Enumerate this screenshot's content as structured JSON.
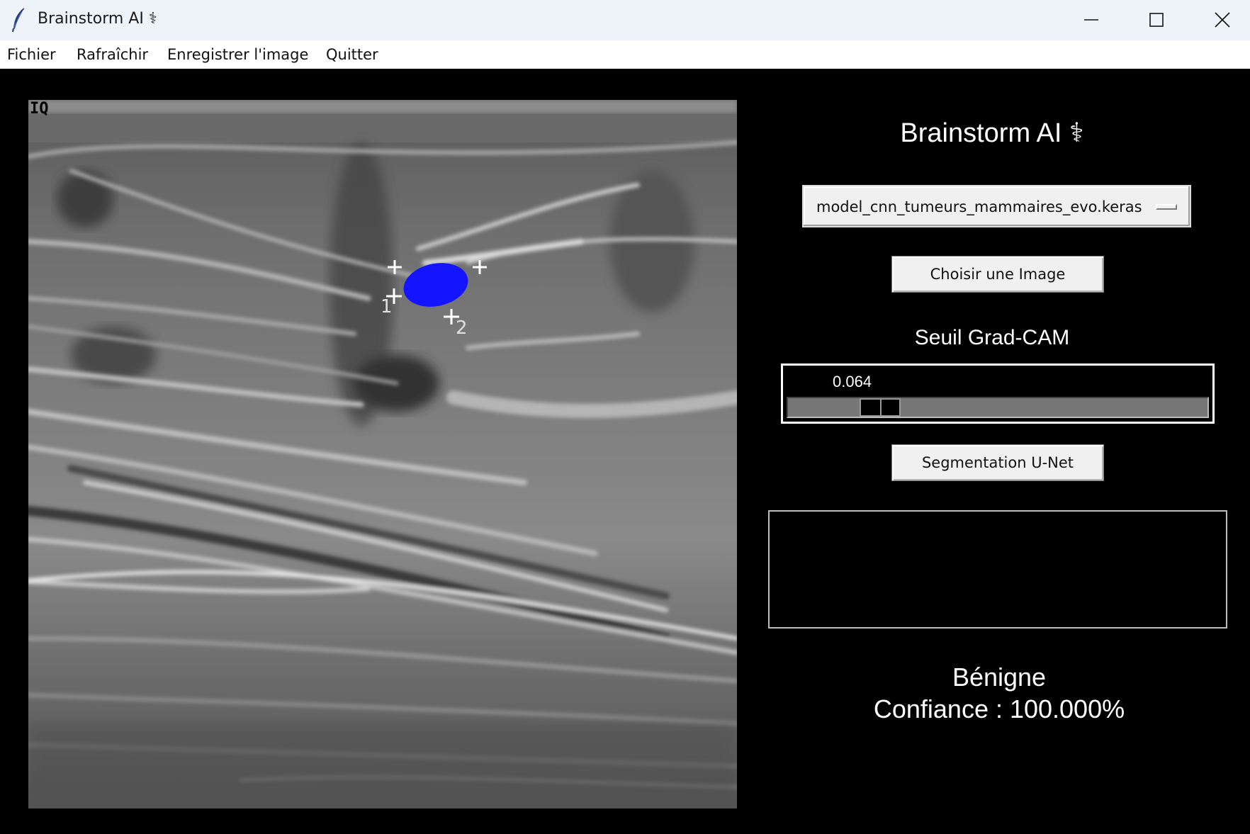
{
  "window": {
    "title": "Brainstorm AI ⚕",
    "app_icon": "feather-icon",
    "controls": [
      "minimize-icon",
      "maximize-icon",
      "close-icon"
    ]
  },
  "menu": {
    "items": [
      "Fichier",
      "Rafraîchir",
      "Enregistrer l'image",
      "Quitter"
    ]
  },
  "image": {
    "overlay_label": "IQ",
    "markers": [
      "1",
      "2"
    ],
    "segmentation_color": "#1414ff"
  },
  "panel": {
    "title": "Brainstorm AI  ⚕",
    "model_select": "model_cnn_tumeurs_mammaires_evo.keras",
    "choose_button": "Choisir une Image",
    "threshold_label": "Seuil Grad-CAM",
    "threshold": {
      "value_text": "0.064",
      "value": 0.064,
      "min": 0.0,
      "max": 1.0
    },
    "segmentation_button": "Segmentation U-Net",
    "prediction": "Bénigne",
    "confidence": "Confiance : 100.000%"
  },
  "colors": {
    "background": "#000000",
    "titlebar": "#eef3fa",
    "button": "#f0f0f0"
  }
}
